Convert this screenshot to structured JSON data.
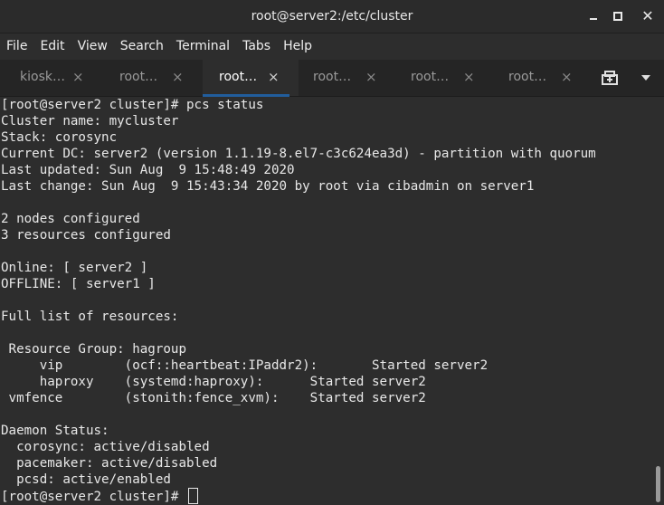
{
  "window": {
    "title": "root@server2:/etc/cluster"
  },
  "menu": [
    "File",
    "Edit",
    "View",
    "Search",
    "Terminal",
    "Tabs",
    "Help"
  ],
  "tabs": [
    {
      "label": "kiosk…",
      "active": false
    },
    {
      "label": "root…",
      "active": false
    },
    {
      "label": "root…",
      "active": true
    },
    {
      "label": "root…",
      "active": false
    },
    {
      "label": "root…",
      "active": false
    },
    {
      "label": "root…",
      "active": false
    }
  ],
  "tab_close_glyph": "×",
  "terminal": {
    "lines": [
      "[root@server2 cluster]# pcs status",
      "Cluster name: mycluster",
      "Stack: corosync",
      "Current DC: server2 (version 1.1.19-8.el7-c3c624ea3d) - partition with quorum",
      "Last updated: Sun Aug  9 15:48:49 2020",
      "Last change: Sun Aug  9 15:43:34 2020 by root via cibadmin on server1",
      "",
      "2 nodes configured",
      "3 resources configured",
      "",
      "Online: [ server2 ]",
      "OFFLINE: [ server1 ]",
      "",
      "Full list of resources:",
      "",
      " Resource Group: hagroup",
      "     vip        (ocf::heartbeat:IPaddr2):       Started server2",
      "     haproxy    (systemd:haproxy):      Started server2",
      " vmfence        (stonith:fence_xvm):    Started server2",
      "",
      "Daemon Status:",
      "  corosync: active/disabled",
      "  pacemaker: active/disabled",
      "  pcsd: active/enabled",
      "[root@server2 cluster]# "
    ]
  },
  "icons": {
    "minimize": "minimize-icon",
    "maximize": "maximize-icon",
    "close": "close-icon",
    "new_tab": "new-tab-icon",
    "dropdown": "chevron-down-icon"
  },
  "colors": {
    "background": "#2d2d2d",
    "text": "#e8e8e8",
    "active_tab_underline": "#215d9c"
  }
}
